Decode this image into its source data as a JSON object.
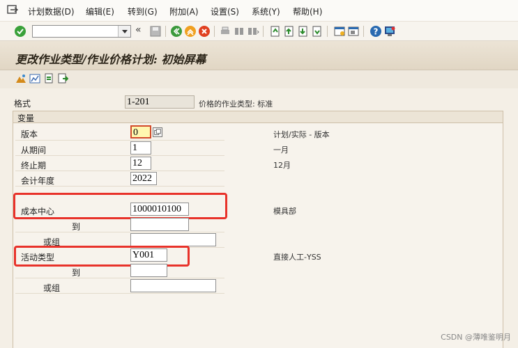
{
  "menubar": {
    "items": [
      "计划数据(D)",
      "编辑(E)",
      "转到(G)",
      "附加(A)",
      "设置(S)",
      "系统(Y)",
      "帮助(H)"
    ]
  },
  "toolbar": {
    "command_value": "",
    "chevron": "«"
  },
  "title": "更改作业类型/作业价格计划: 初始屏幕",
  "layout": {
    "label": "格式",
    "value": "1-201",
    "description": "价格的作业类型: 标准"
  },
  "variables": {
    "title": "变量",
    "version": {
      "label": "版本",
      "value": "0",
      "description": "计划/实际 - 版本"
    },
    "from_period": {
      "label": "从期间",
      "value": "1",
      "description": "一月"
    },
    "to_period": {
      "label": "终止期",
      "value": "12",
      "description": "12月"
    },
    "fiscal_year": {
      "label": "会计年度",
      "value": "2022"
    },
    "cost_center": {
      "label": "成本中心",
      "value": "1000010100",
      "description": "模具部",
      "to_label": "到",
      "to_value": "",
      "group_label": "或组",
      "group_value": ""
    },
    "activity_type": {
      "label": "活动类型",
      "value": "Y001",
      "description": "直接人工-YSS",
      "to_label": "到",
      "to_value": "",
      "group_label": "或组",
      "group_value": ""
    }
  },
  "watermark": "CSDN @薄唯鉴明月",
  "colors": {
    "highlight_box": "#e8322a",
    "title_bg": "#e1d6c4",
    "focus_field": "#fff7b0"
  }
}
